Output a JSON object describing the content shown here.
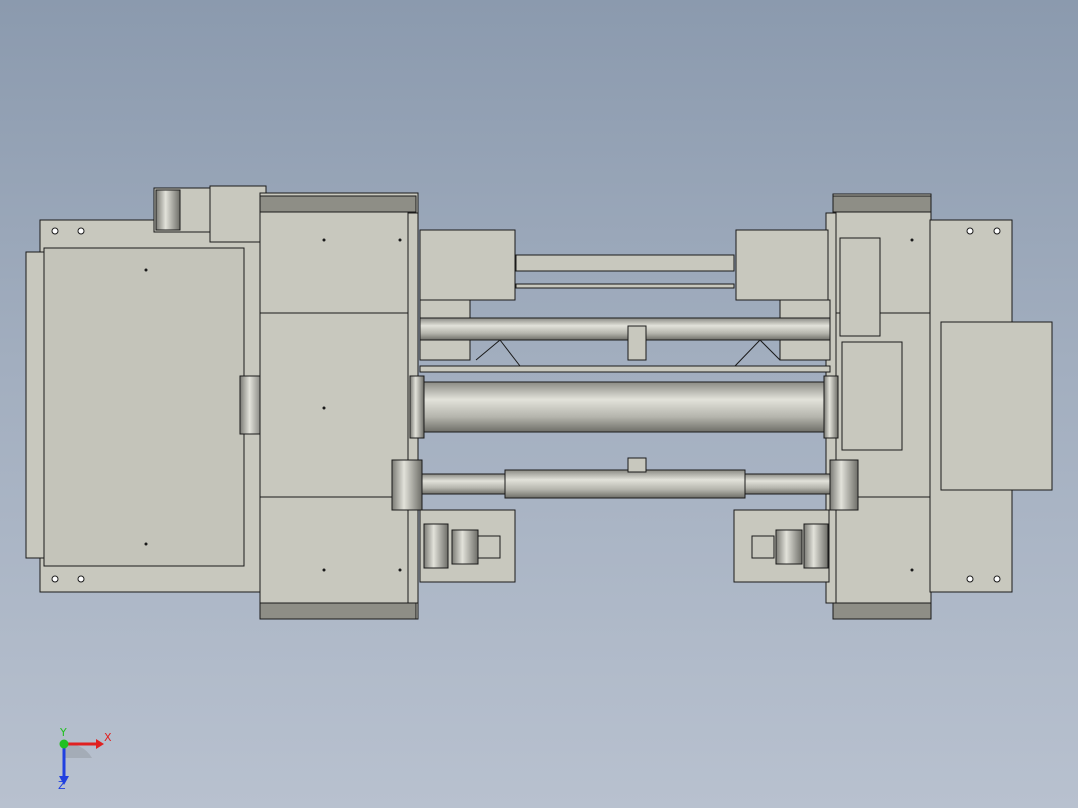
{
  "view": {
    "background_top": "#8b9aae",
    "background_bottom": "#b8c1cf",
    "part_color": "#c8c8be",
    "edge_color": "#1a1a1a"
  },
  "triad": {
    "x_label": "X",
    "y_label": "Y",
    "z_label": "Z",
    "x_color": "#e02020",
    "y_color": "#20c020",
    "z_color": "#2040e0"
  }
}
